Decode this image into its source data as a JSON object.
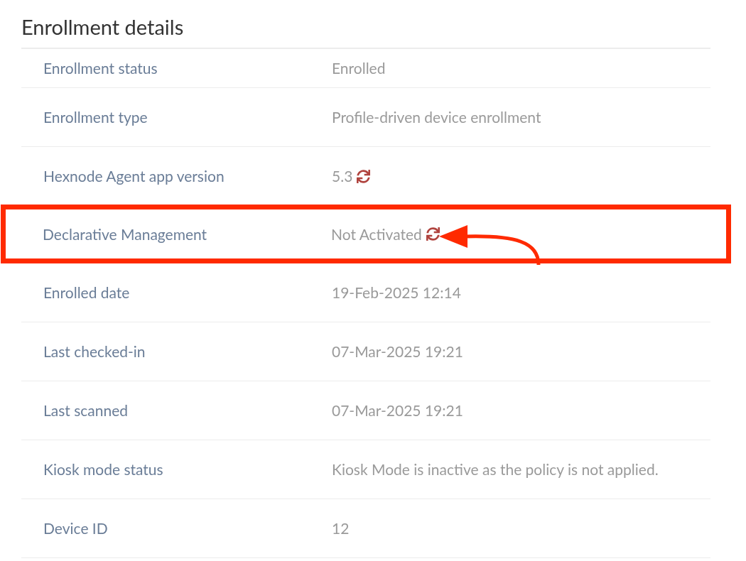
{
  "title": "Enrollment details",
  "rows": [
    {
      "label": "Enrollment status",
      "value": "Enrolled",
      "kind": "text",
      "highlighted": false
    },
    {
      "label": "Enrollment type",
      "value": "Profile-driven device enrollment",
      "kind": "text",
      "highlighted": false
    },
    {
      "label": "Hexnode Agent app version",
      "value": "5.3",
      "kind": "refresh",
      "highlighted": false
    },
    {
      "label": "Declarative Management",
      "value": "Not Activated",
      "kind": "refresh",
      "highlighted": true
    },
    {
      "label": "Enrolled date",
      "value": "19-Feb-2025 12:14",
      "kind": "text",
      "highlighted": false
    },
    {
      "label": "Last checked-in",
      "value": "07-Mar-2025 19:21",
      "kind": "text",
      "highlighted": false
    },
    {
      "label": "Last scanned",
      "value": "07-Mar-2025 19:21",
      "kind": "text",
      "highlighted": false
    },
    {
      "label": "Kiosk mode status",
      "value": "Kiosk Mode is inactive as the policy is not applied.",
      "kind": "text",
      "highlighted": false
    },
    {
      "label": "Device ID",
      "value": "12",
      "kind": "text",
      "highlighted": false
    }
  ]
}
